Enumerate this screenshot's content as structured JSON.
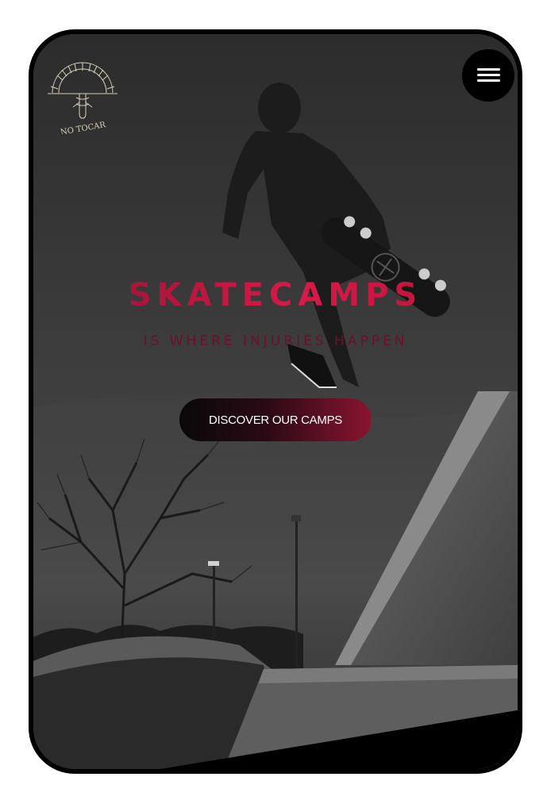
{
  "brand": {
    "logo_text": "NO TOCAR"
  },
  "header": {
    "menu_icon": "hamburger-menu-icon"
  },
  "hero": {
    "title": "SKATECAMPS",
    "subtitle": "IS WHERE INJURIES HAPPEN",
    "cta_label": "DISCOVER OUR CAMPS"
  },
  "colors": {
    "accent": "#c4163f",
    "accent_dark": "#6e1029",
    "background": "#2e2e2e"
  }
}
